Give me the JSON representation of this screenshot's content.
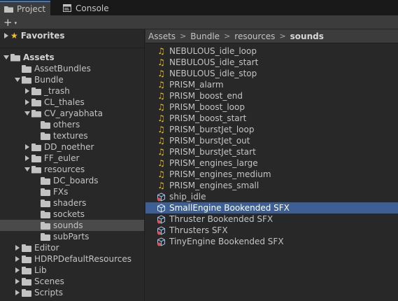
{
  "tabs": [
    {
      "label": "Project",
      "icon": "folder-icon",
      "active": true
    },
    {
      "label": "Console",
      "icon": "console-icon",
      "active": false
    }
  ],
  "toolbar": {
    "add_label": "+",
    "add_caret": "▾"
  },
  "tree": {
    "favorites": "Favorites",
    "assets": "Assets",
    "items": [
      {
        "label": "AssetBundles"
      },
      {
        "label": "Bundle"
      },
      {
        "label": "_trash"
      },
      {
        "label": "CL_thales"
      },
      {
        "label": "CV_aryabhata"
      },
      {
        "label": "others"
      },
      {
        "label": "textures"
      },
      {
        "label": "DD_noether"
      },
      {
        "label": "FF_euler"
      },
      {
        "label": "resources"
      },
      {
        "label": "DC_boards"
      },
      {
        "label": "FXs"
      },
      {
        "label": "shaders"
      },
      {
        "label": "sockets"
      },
      {
        "label": "sounds"
      },
      {
        "label": "subParts"
      },
      {
        "label": "Editor"
      },
      {
        "label": "HDRPDefaultResources"
      },
      {
        "label": "Lib"
      },
      {
        "label": "Scenes"
      },
      {
        "label": "Scripts"
      }
    ]
  },
  "breadcrumb": [
    "Assets",
    "Bundle",
    "resources",
    "sounds"
  ],
  "breadcrumb_separator": ">",
  "files": [
    {
      "name": "NEBULOUS_idle_loop",
      "type": "audio"
    },
    {
      "name": "NEBULOUS_idle_start",
      "type": "audio"
    },
    {
      "name": "NEBULOUS_idle_stop",
      "type": "audio"
    },
    {
      "name": "PRISM_alarm",
      "type": "audio"
    },
    {
      "name": "PRISM_boost_end",
      "type": "audio"
    },
    {
      "name": "PRISM_boost_loop",
      "type": "audio"
    },
    {
      "name": "PRISM_boost_start",
      "type": "audio"
    },
    {
      "name": "PRISM_burstJet_loop",
      "type": "audio"
    },
    {
      "name": "PRISM_burstJet_out",
      "type": "audio"
    },
    {
      "name": "PRISM_burstJet_start",
      "type": "audio"
    },
    {
      "name": "PRISM_engines_large",
      "type": "audio"
    },
    {
      "name": "PRISM_engines_medium",
      "type": "audio"
    },
    {
      "name": "PRISM_engines_small",
      "type": "audio"
    },
    {
      "name": "ship_idle",
      "type": "prefab"
    },
    {
      "name": "SmallEngine Bookended SFX",
      "type": "prefab",
      "selected": true
    },
    {
      "name": "Thruster Bookended SFX",
      "type": "prefab"
    },
    {
      "name": "Thrusters SFX",
      "type": "prefab"
    },
    {
      "name": "TinyEngine Bookended SFX",
      "type": "prefab"
    }
  ],
  "colors": {
    "selection": "#3e5f96",
    "audio_icon": "#f2c12e",
    "tab_accent": "#3a79bb"
  }
}
